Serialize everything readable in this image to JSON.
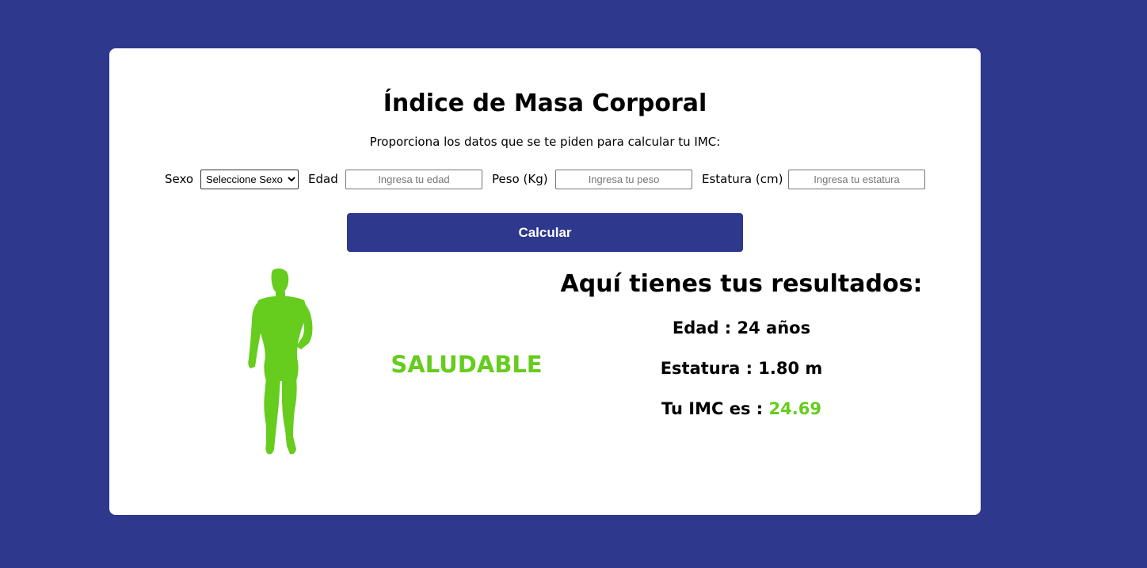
{
  "title": "Índice de Masa Corporal",
  "subtitle": "Proporciona los datos que se te piden para calcular tu IMC:",
  "form": {
    "sexo_label": "Sexo",
    "sexo_selected": "Seleccione Sexo",
    "edad_label": "Edad",
    "edad_placeholder": "Ingresa tu edad",
    "peso_label": "Peso (Kg)",
    "peso_placeholder": "Ingresa tu peso",
    "estatura_label": "Estatura (cm)",
    "estatura_placeholder": "Ingresa tu estatura"
  },
  "calculate_label": "Calcular",
  "status": "SALUDABLE",
  "results": {
    "title": "Aquí tienes tus resultados:",
    "edad_text": "Edad : 24 años",
    "estatura_text": "Estatura : 1.80 m",
    "imc_prefix": "Tu IMC es : ",
    "imc_value": "24.69"
  },
  "colors": {
    "background": "#2e388d",
    "card": "#ffffff",
    "accent_green": "#66cc1e",
    "button": "#2e388d"
  },
  "icons": {
    "figure": "human-silhouette-icon"
  }
}
